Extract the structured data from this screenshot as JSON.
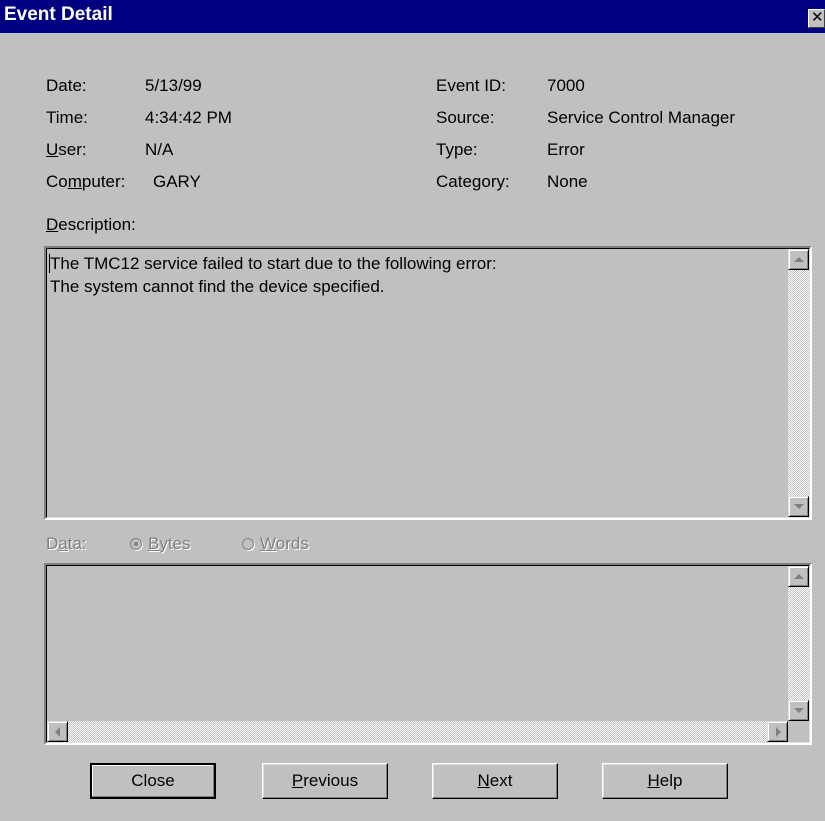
{
  "window": {
    "title": "Event Detail",
    "close_glyph": "✕"
  },
  "fields": {
    "date_label": "Date:",
    "date_value": "5/13/99",
    "time_label": "Time:",
    "time_value": "4:34:42 PM",
    "user_label_pre": "",
    "user_label_mn": "U",
    "user_label_post": "ser:",
    "user_value": "N/A",
    "computer_label_pre": "Co",
    "computer_label_mn": "m",
    "computer_label_post": "puter:",
    "computer_value": "GARY",
    "event_id_label": "Event ID:",
    "event_id_value": "7000",
    "source_label": "Source:",
    "source_value": "Service Control Manager",
    "type_label": "Type:",
    "type_value": "Error",
    "category_label": "Category:",
    "category_value": "None"
  },
  "description": {
    "label_mn": "D",
    "label_post": "escription:",
    "line1": "The TMC12 service failed to start due to the following error:",
    "line2": "The system cannot find the device specified."
  },
  "data_section": {
    "label_pre": "D",
    "label_mn": "a",
    "label_post": "ta:",
    "bytes_mn": "B",
    "bytes_post": "ytes",
    "words_mn": "W",
    "words_post": "ords",
    "selected": "Bytes"
  },
  "buttons": {
    "close": "Close",
    "previous_mn": "P",
    "previous_post": "revious",
    "next_mn": "N",
    "next_post": "ext",
    "help_mn": "H",
    "help_post": "elp"
  },
  "colors": {
    "titlebar": "#000080",
    "face": "#c0c0c0",
    "disabled_text": "#808080"
  },
  "icons": [
    "close-icon",
    "scroll-up-icon",
    "scroll-down-icon",
    "scroll-left-icon",
    "scroll-right-icon",
    "radio-icon"
  ]
}
